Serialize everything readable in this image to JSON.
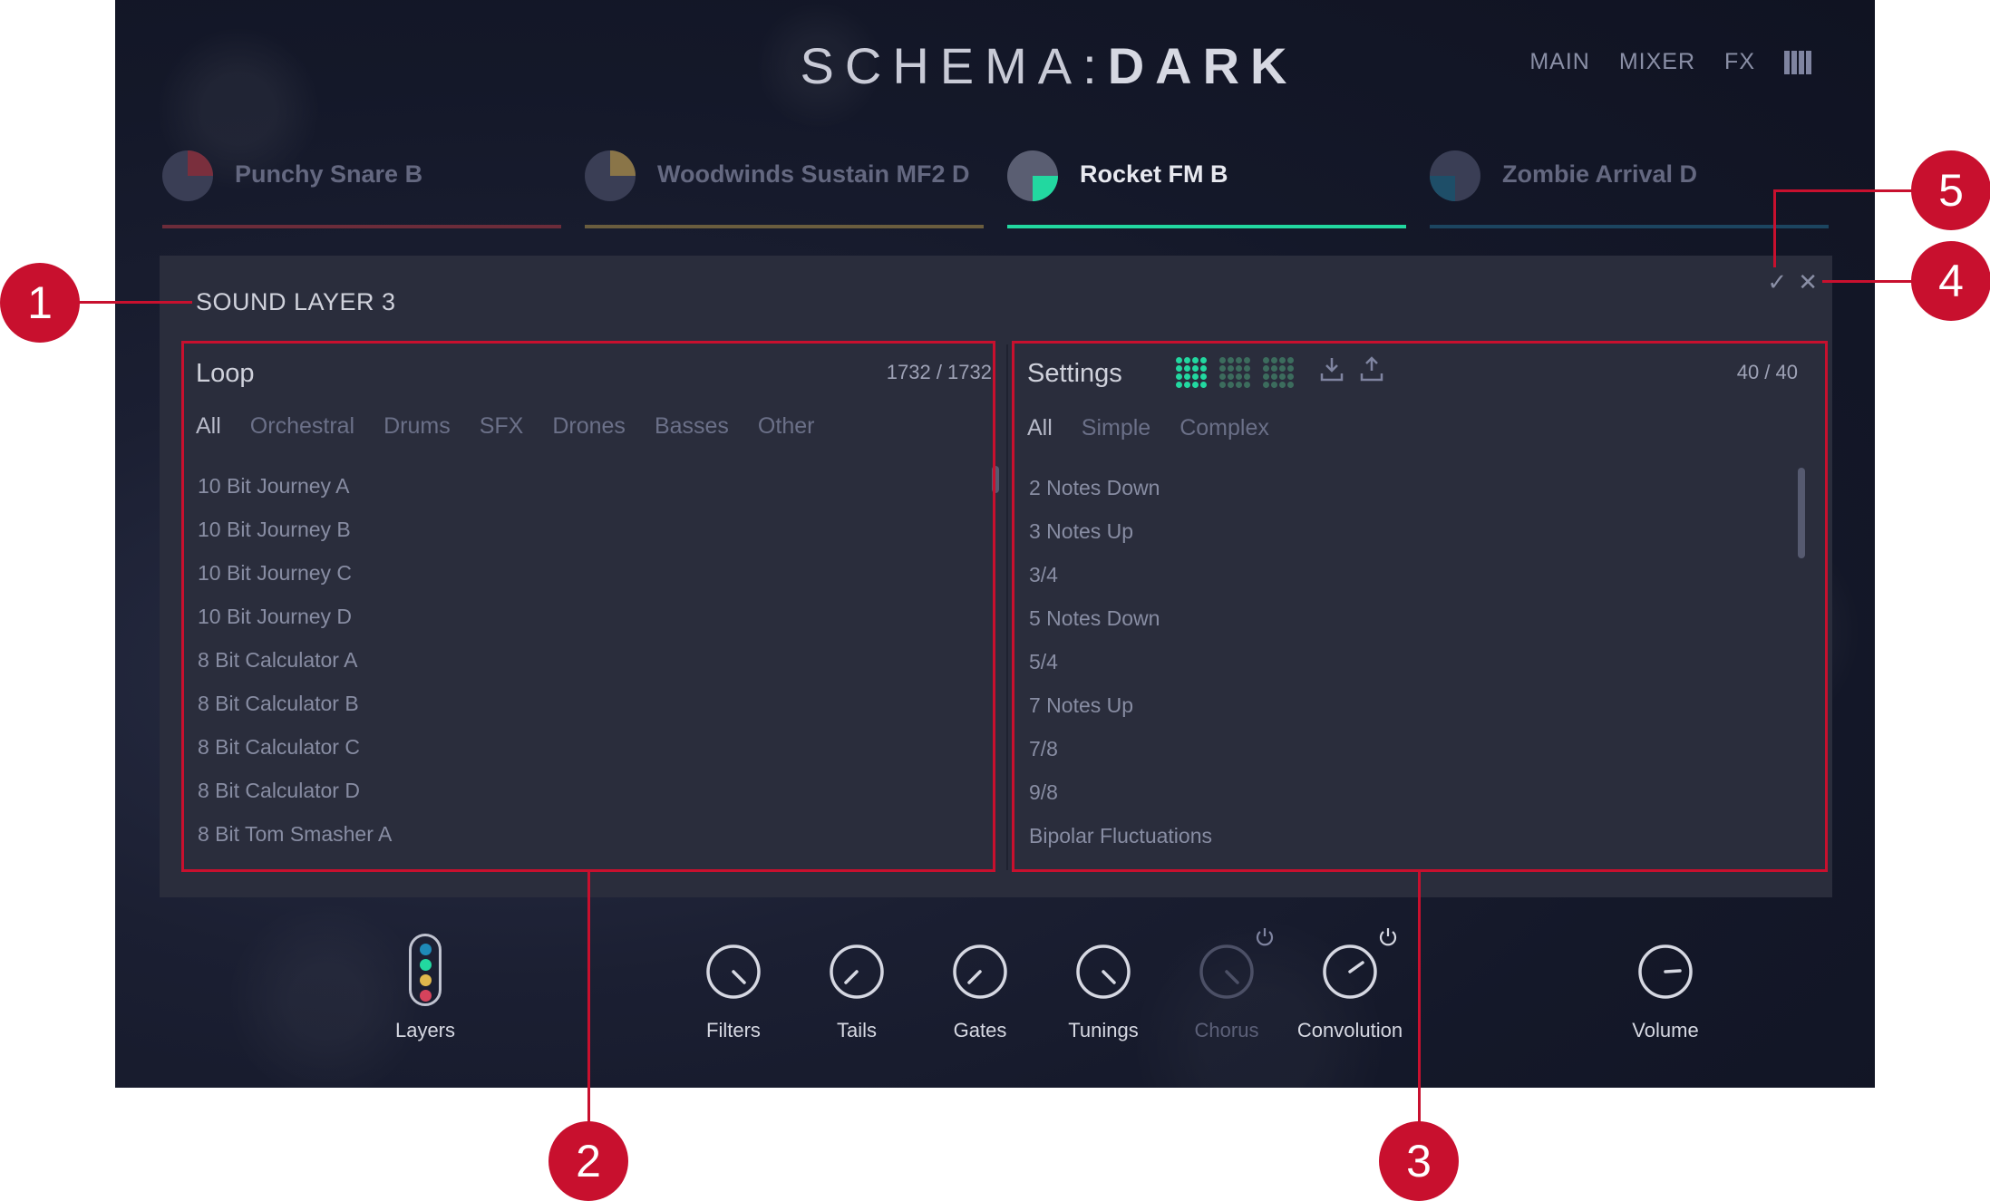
{
  "header": {
    "logo_light": "SCHEMA:",
    "logo_bold": "DARK",
    "nav": [
      "MAIN",
      "MIXER",
      "FX"
    ]
  },
  "tabs": [
    {
      "label": "Punchy Snare B",
      "color": "#b43c4e"
    },
    {
      "label": "Woodwinds Sustain MF2 D",
      "color": "#a8925c"
    },
    {
      "label": "Rocket FM B",
      "color": "#22d8a0"
    },
    {
      "label": "Zombie Arrival D",
      "color": "#1e5a7a"
    }
  ],
  "panel": {
    "title": "SOUND LAYER 3",
    "confirm_icon": "checkmark-icon",
    "close_icon": "close-icon"
  },
  "loop_browser": {
    "title": "Loop",
    "count": "1732 / 1732",
    "filters": [
      "All",
      "Orchestral",
      "Drums",
      "SFX",
      "Drones",
      "Basses",
      "Other"
    ],
    "items": [
      "10 Bit Journey A",
      "10 Bit Journey B",
      "10 Bit Journey C",
      "10 Bit Journey D",
      "8 Bit Calculator A",
      "8 Bit Calculator B",
      "8 Bit Calculator C",
      "8 Bit Calculator D",
      "8 Bit Tom Smasher A"
    ]
  },
  "settings_browser": {
    "title": "Settings",
    "count": "40 / 40",
    "filters": [
      "All",
      "Simple",
      "Complex"
    ],
    "items": [
      "2 Notes Down",
      "3 Notes Up",
      "3/4",
      "5 Notes Down",
      "5/4",
      "7 Notes Up",
      "7/8",
      "9/8",
      "Bipolar Fluctuations"
    ]
  },
  "bottom_bar": {
    "layers_label": "Layers",
    "knobs": [
      "Filters",
      "Tails",
      "Gates",
      "Tunings",
      "Chorus",
      "Convolution"
    ],
    "volume_label": "Volume"
  },
  "callouts": [
    "1",
    "2",
    "3",
    "4",
    "5"
  ],
  "colors": {
    "accent": "#22d8a0",
    "annotation": "#c8102e",
    "panel_bg": "#2a2d3c"
  }
}
